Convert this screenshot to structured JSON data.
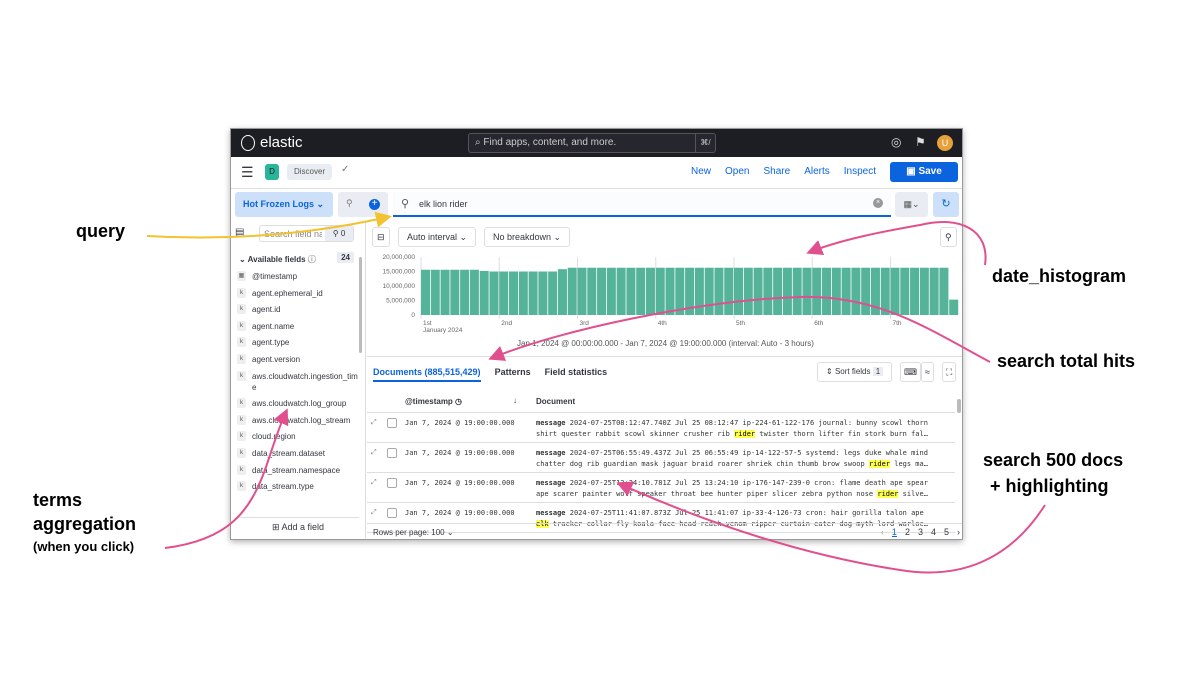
{
  "topbar": {
    "brand": "elastic",
    "search_placeholder": "Find apps, content, and more.",
    "shortcut": "⌘/",
    "avatar": "U"
  },
  "navbar": {
    "app_badge": "D",
    "breadcrumb": "Discover",
    "links": [
      "New",
      "Open",
      "Share",
      "Alerts",
      "Inspect"
    ],
    "save": "Save"
  },
  "query": {
    "data_view": "Hot Frozen Logs",
    "value": "elk lion rider"
  },
  "sidebar": {
    "search_placeholder": "Search field names",
    "filter_count": "0",
    "available_label": "Available fields",
    "available_count": "24",
    "fields": [
      {
        "t": "date",
        "n": "@timestamp"
      },
      {
        "t": "k",
        "n": "agent.ephemeral_id"
      },
      {
        "t": "k",
        "n": "agent.id"
      },
      {
        "t": "k",
        "n": "agent.name"
      },
      {
        "t": "k",
        "n": "agent.type"
      },
      {
        "t": "k",
        "n": "agent.version"
      },
      {
        "t": "k",
        "n": "aws.cloudwatch.ingestion_time"
      },
      {
        "t": "k",
        "n": "aws.cloudwatch.log_group"
      },
      {
        "t": "k",
        "n": "aws.cloudwatch.log_stream"
      },
      {
        "t": "k",
        "n": "cloud.region"
      },
      {
        "t": "k",
        "n": "data_stream.dataset"
      },
      {
        "t": "k",
        "n": "data_stream.namespace"
      },
      {
        "t": "k",
        "n": "data_stream.type"
      }
    ],
    "add_field": "Add a field"
  },
  "histogram_controls": {
    "interval": "Auto interval",
    "breakdown": "No breakdown"
  },
  "chart_data": {
    "type": "bar",
    "title": "",
    "xlabel": "",
    "ylabel": "",
    "ylim": [
      0,
      20000000
    ],
    "yticks": [
      "0",
      "5,000,000",
      "10,000,000",
      "15,000,000",
      "20,000,000"
    ],
    "xticks": [
      "1st",
      "2nd",
      "3rd",
      "4th",
      "5th",
      "6th",
      "7th"
    ],
    "x_sub": "January 2024",
    "bar_color": "#54b399",
    "values": [
      15600000,
      15600000,
      15600000,
      15600000,
      15600000,
      15600000,
      15200000,
      15000000,
      15000000,
      15000000,
      15000000,
      15000000,
      15000000,
      15000000,
      15800000,
      16300000,
      16300000,
      16300000,
      16300000,
      16300000,
      16300000,
      16300000,
      16300000,
      16300000,
      16300000,
      16300000,
      16300000,
      16300000,
      16300000,
      16300000,
      16300000,
      16300000,
      16300000,
      16300000,
      16300000,
      16300000,
      16300000,
      16300000,
      16300000,
      16300000,
      16300000,
      16300000,
      16300000,
      16300000,
      16300000,
      16300000,
      16300000,
      16300000,
      16300000,
      16300000,
      16300000,
      16300000,
      16300000,
      16300000,
      5300000
    ],
    "caption": "Jan 1, 2024 @ 00:00:00.000 - Jan 7, 2024 @ 19:00:00.000 (interval: Auto - 3 hours)"
  },
  "tabs": [
    "Documents (885,515,429)",
    "Patterns",
    "Field statistics"
  ],
  "sort_fields": "Sort fields",
  "sort_count": "1",
  "columns": [
    "@timestamp",
    "Document"
  ],
  "rows": [
    {
      "ts": "Jan 7, 2024 @ 19:00:00.000",
      "l1": "2024-07-25T08:12:47.740Z Jul 25 08:12:47 ip-224-61-122-176 journal: bunny scowl thorn",
      "l2a": "shirt quester rabbit scowl skinner crusher rib ",
      "hl": "rider",
      "l2b": " twister thorn lifter fin stork burn fal…"
    },
    {
      "ts": "Jan 7, 2024 @ 19:00:00.000",
      "l1": "2024-07-25T06:55:49.437Z Jul 25 06:55:49 ip-14-122-57-5 systemd: legs duke whale mind",
      "l2a": "chatter dog rib guardian mask jaguar braid roarer shriek chin thumb brow swoop ",
      "hl": "rider",
      "l2b": " legs ma…"
    },
    {
      "ts": "Jan 7, 2024 @ 19:00:00.000",
      "l1": "2024-07-25T13:24:10.781Z Jul 25 13:24:10 ip-176-147-239-0 cron: flame death ape spear",
      "l2a": "ape scarer painter wolf speaker throat bee hunter piper slicer zebra python nose ",
      "hl": "rider",
      "l2b": " silve…"
    },
    {
      "ts": "Jan 7, 2024 @ 19:00:00.000",
      "l1": "2024-07-25T11:41:07.873Z Jul 25 11:41:07 ip-33-4-126-73 cron: hair gorilla talon ape",
      "l2a": "",
      "hl": "elk",
      "l2b": " tracker collar fly koala face head reach venom ripper curtain eater dog myth lord warloc…"
    }
  ],
  "field_label": "message",
  "rows_per_page": "Rows per page: 100",
  "pages": [
    "1",
    "2",
    "3",
    "4",
    "5"
  ],
  "annotations": {
    "query": "query",
    "date_histogram": "date_histogram",
    "total_hits": "search total hits",
    "docs1": "search 500 docs",
    "docs2": "+ highlighting",
    "terms1": "terms",
    "terms2": "aggregation",
    "terms3": "(when you click)"
  }
}
